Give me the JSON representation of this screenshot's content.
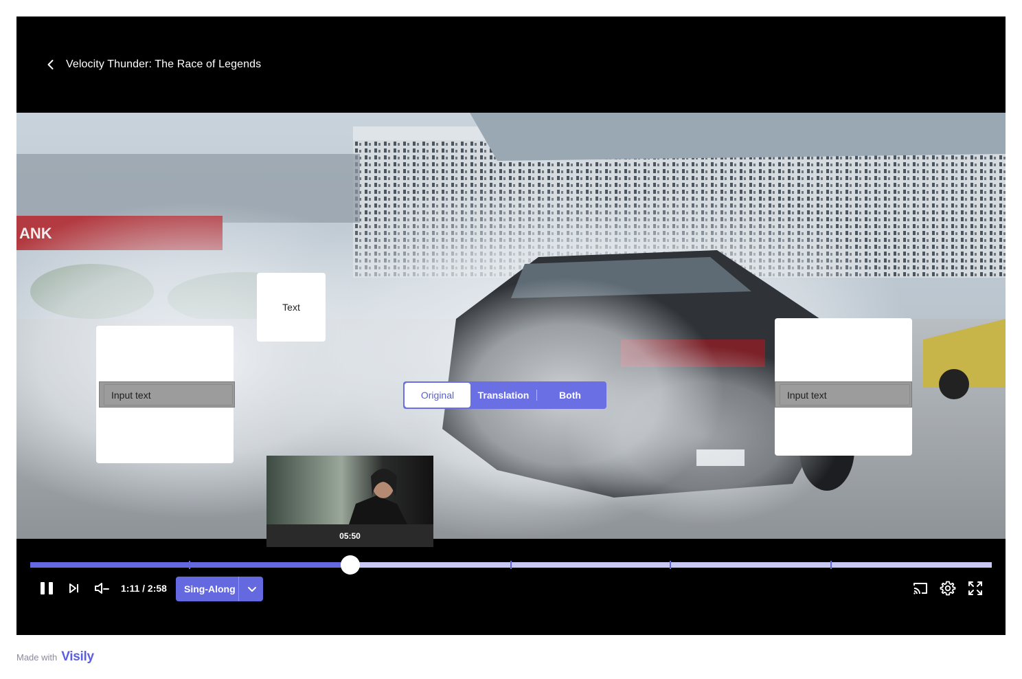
{
  "header": {
    "title": "Velocity Thunder: The Race of Legends"
  },
  "overlay": {
    "input_left_placeholder": "Input text",
    "input_right_placeholder": "Input text",
    "text_card": "Text",
    "mode_toggle": {
      "options": [
        "Original",
        "Translation",
        "Both"
      ],
      "selected": "Original"
    }
  },
  "preview": {
    "time": "05:50"
  },
  "scene": {
    "bank_sign": "ANK"
  },
  "progress": {
    "played_fraction": 0.333,
    "chapter_marks": [
      0.166,
      0.5,
      0.666,
      0.833
    ]
  },
  "controls": {
    "time": "1:11 / 2:58",
    "mode_label": "Sing-Along"
  },
  "footer": {
    "made_with": "Made with",
    "brand": "Visily"
  },
  "colors": {
    "accent": "#6569E0",
    "progress_track": "#C7C8F3"
  }
}
